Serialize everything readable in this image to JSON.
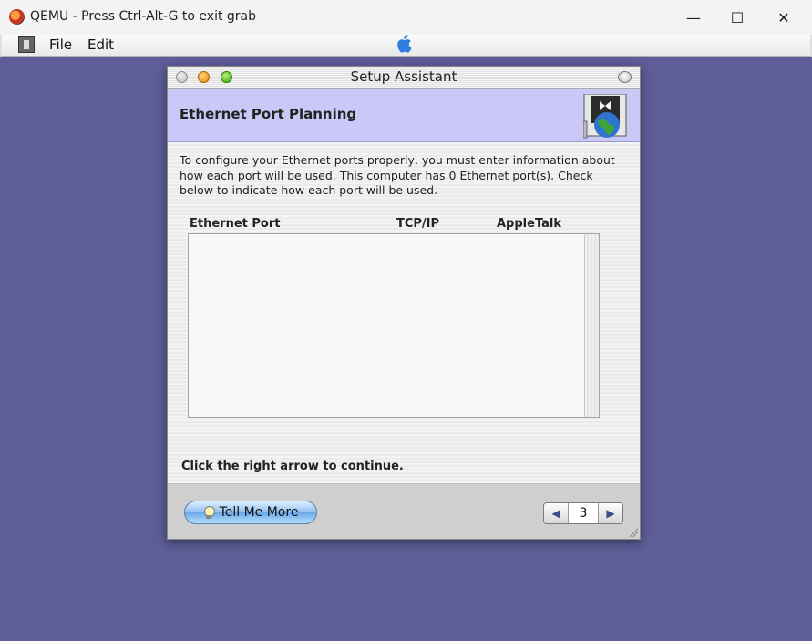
{
  "host_window": {
    "title": "QEMU - Press Ctrl-Alt-G to exit grab",
    "controls": {
      "minimize": "—",
      "maximize": "☐",
      "close": "✕"
    }
  },
  "guest_menubar": {
    "items": [
      "File",
      "Edit"
    ],
    "apple_glyph": ""
  },
  "setup_assistant": {
    "window_title": "Setup Assistant",
    "header_title": "Ethernet Port Planning",
    "description": "To configure your Ethernet ports properly, you must enter information about how each port will be used.  This computer has 0 Ethernet port(s).  Check below to indicate how each port will be used.",
    "table": {
      "columns": [
        "Ethernet Port",
        "TCP/IP",
        "AppleTalk"
      ],
      "rows": []
    },
    "footnote": "Click the right arrow to continue.",
    "tell_me_more": "Tell Me More",
    "nav": {
      "prev": "◀",
      "page": "3",
      "next": "▶"
    }
  },
  "colors": {
    "desktop": "#5e5d98",
    "header_band": "#c9c8f7",
    "aqua_button": "#8dbff0"
  }
}
